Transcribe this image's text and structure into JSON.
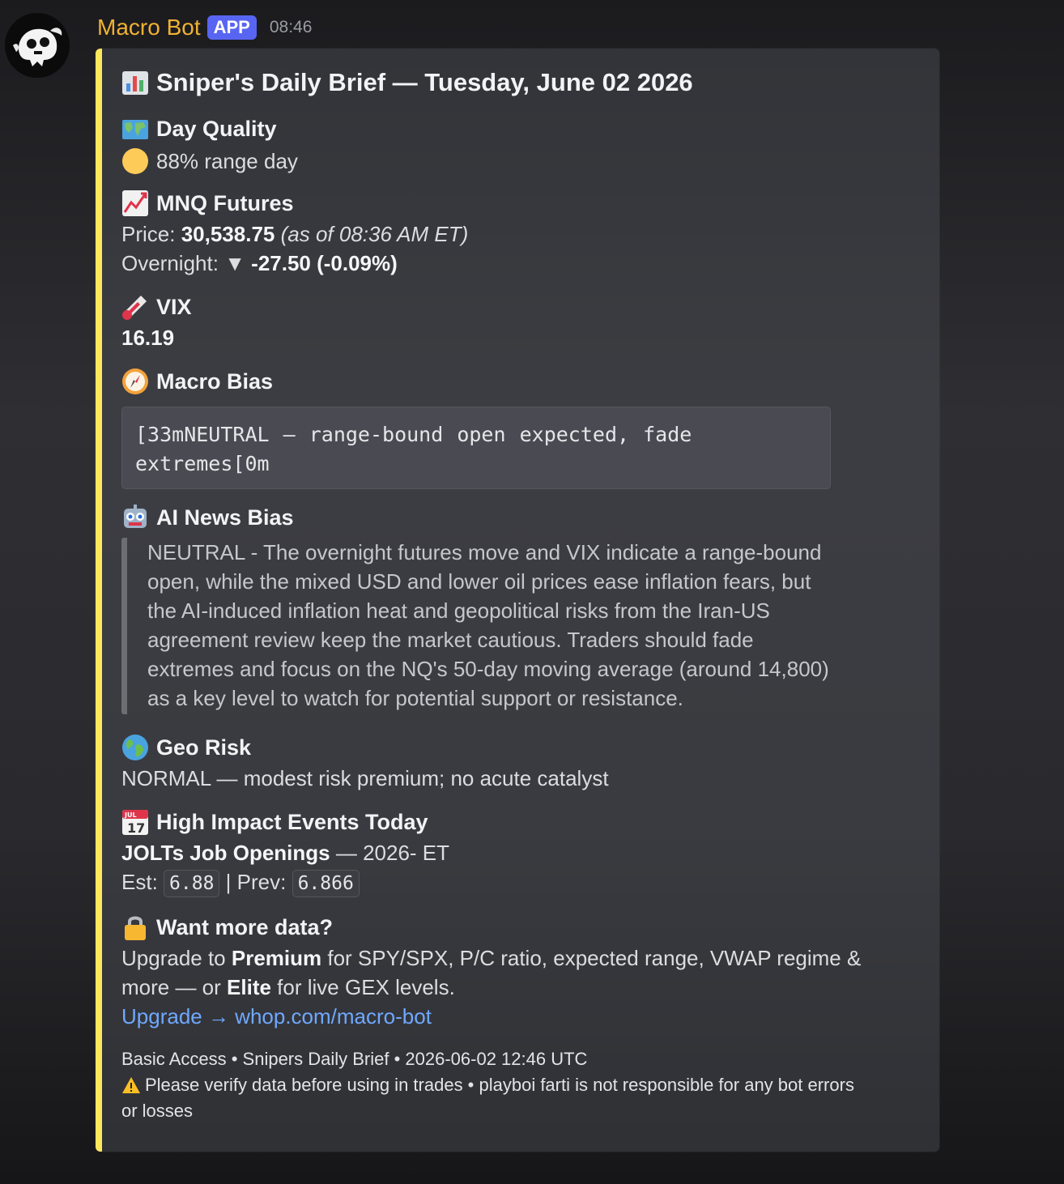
{
  "message": {
    "username": "Macro Bot",
    "badge": "APP",
    "timestamp": "08:46",
    "avatar_icon": "ghost-skull-avatar-icon"
  },
  "embed": {
    "accent_color": "#fee75c",
    "title_icon": "bar-chart-icon",
    "title": "Sniper's Daily Brief — Tuesday, June 02 2026",
    "day_quality": {
      "icon": "world-map-icon",
      "label": "Day Quality",
      "indicator_icon": "yellow-circle-icon",
      "value": "88% range day"
    },
    "mnq": {
      "icon": "chart-increasing-icon",
      "label": "MNQ Futures",
      "price_label": "Price:",
      "price": "30,538.75",
      "price_note": "(as of 08:36 AM ET)",
      "overnight_label": "Overnight:",
      "overnight_arrow": "▼",
      "overnight_value": "-27.50 (-0.09%)"
    },
    "vix": {
      "icon": "thermometer-icon",
      "label": "VIX",
      "value": "16.19"
    },
    "macro_bias": {
      "icon": "compass-icon",
      "label": "Macro Bias",
      "code": "[33mNEUTRAL — range-bound open expected, fade extremes[0m"
    },
    "ai_news": {
      "icon": "robot-icon",
      "label": "AI News Bias",
      "text": "NEUTRAL - The overnight futures move and VIX indicate a range-bound open, while the mixed USD and lower oil prices ease inflation fears, but the AI-induced inflation heat and geopolitical risks from the Iran-US agreement review keep the market cautious. Traders should fade extremes and focus on the NQ's 50-day moving average (around 14,800) as a key level to watch for potential support or resistance."
    },
    "geo_risk": {
      "icon": "globe-icon",
      "label": "Geo Risk",
      "value": "NORMAL — modest risk premium; no acute catalyst"
    },
    "events": {
      "icon": "calendar-icon",
      "calendar_month": "JUL",
      "calendar_day": "17",
      "label": "High Impact Events Today",
      "event_name": "JOLTs Job Openings",
      "event_time": "— 2026- ET",
      "est_label": "Est:",
      "est_value": "6.88",
      "separator": "|",
      "prev_label": "Prev:",
      "prev_value": "6.866"
    },
    "upsell": {
      "icon": "lock-icon",
      "label": "Want more data?",
      "text_1": "Upgrade to ",
      "premium": "Premium",
      "text_2": " for SPY/SPX, P/C ratio, expected range, VWAP regime &",
      "text_3": "more — or ",
      "elite": "Elite",
      "text_4": " for live GEX levels.",
      "link_text": "Upgrade → whop.com/macro-bot"
    },
    "footer": {
      "line_1": "Basic Access • Snipers Daily Brief • 2026-06-02 12:46 UTC",
      "warning_icon": "warning-icon",
      "line_2": "Please verify data before using in trades • playboi farti is not responsible for any bot errors",
      "line_3": "or losses"
    }
  }
}
